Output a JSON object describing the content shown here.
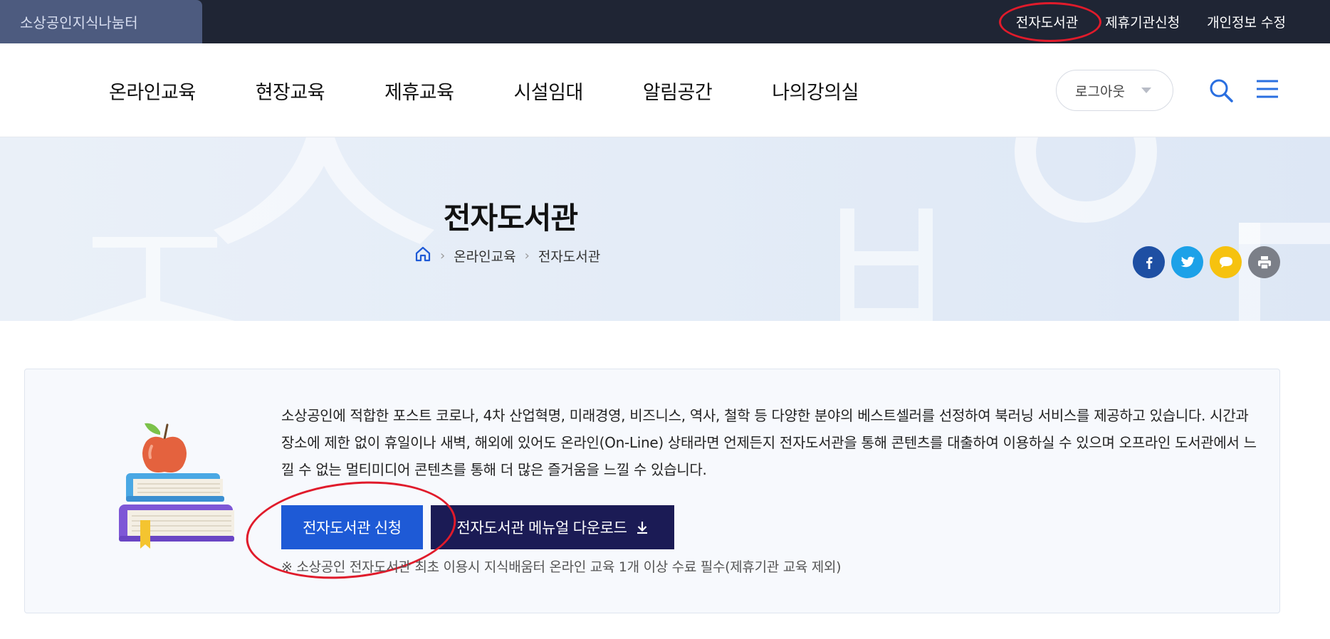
{
  "topbar": {
    "brand": "소상공인지식나눔터",
    "links": [
      "전자도서관",
      "제휴기관신청",
      "개인정보 수정"
    ]
  },
  "nav": {
    "items": [
      "온라인교육",
      "현장교육",
      "제휴교육",
      "시설임대",
      "알림공간",
      "나의강의실"
    ],
    "logout_label": "로그아웃"
  },
  "hero": {
    "title": "전자도서관",
    "breadcrumb": [
      "온라인교육",
      "전자도서관"
    ],
    "share_icons": [
      "facebook-icon",
      "twitter-icon",
      "kakaotalk-icon",
      "print-icon"
    ]
  },
  "info": {
    "description": "소상공인에 적합한 포스트 코로나, 4차 산업혁명, 미래경영, 비즈니스, 역사, 철학 등 다양한 분야의 베스트셀러를 선정하여 북러닝 서비스를 제공하고 있습니다. 시간과 장소에 제한 없이 휴일이나 새벽, 해외에 있어도 온라인(On-Line) 상태라면 언제든지 전자도서관을 통해 콘텐츠를 대출하여 이용하실 수 있으며 오프라인 도서관에서 느낄 수 없는 멀티미디어 콘텐츠를 통해 더 많은 즐거움을 느낄 수 있습니다.",
    "apply_label": "전자도서관 신청",
    "manual_label": "전자도서관 메뉴얼 다운로드",
    "notice": "※ 소상공인 전자도서관 최초 이용시 지식배움터 온라인 교육 1개 이상 수료 필수(제휴기관 교육 제외)"
  },
  "colors": {
    "topbar_bg": "#1f2534",
    "brand_bg": "#4d5b7f",
    "primary_button": "#1e5ad6",
    "dark_button": "#1b1b55",
    "accent_blue": "#2a6fe0",
    "annotation_red": "#e01b2b"
  }
}
